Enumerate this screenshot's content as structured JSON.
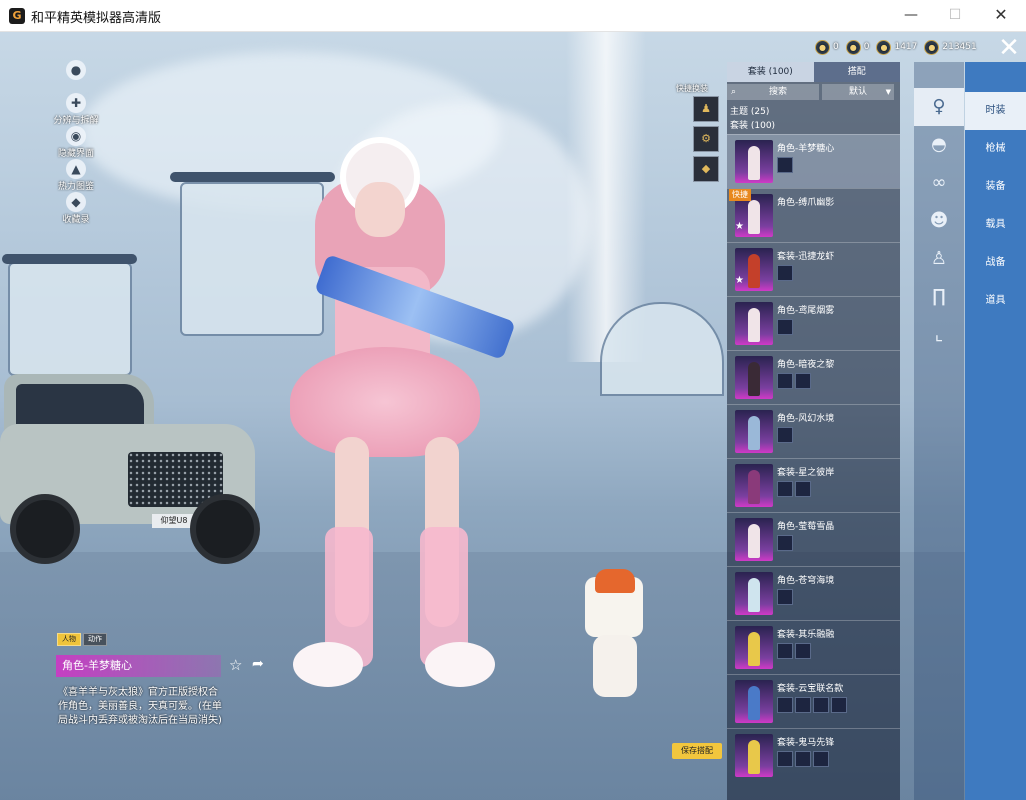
{
  "window": {
    "title": "和平精英模拟器高清版",
    "icon": "G",
    "minimize": "—",
    "maximize": "☐",
    "close": "✕"
  },
  "scene": {
    "car_plate": "仰望U8"
  },
  "left_menu": [
    {
      "icon": "user-icon",
      "glyph": "●",
      "label": ""
    },
    {
      "icon": "share-split-icon",
      "glyph": "✚",
      "label": "分辨与拆解"
    },
    {
      "icon": "eye-icon",
      "glyph": "◉",
      "label": "隐藏界面"
    },
    {
      "icon": "bag-icon",
      "glyph": "▲",
      "label": "热力图鉴"
    },
    {
      "icon": "gift-icon",
      "glyph": "◆",
      "label": "收藏录"
    }
  ],
  "currency": [
    {
      "icon": "token-icon",
      "glyph": "●",
      "value": "0"
    },
    {
      "icon": "badge-icon",
      "glyph": "●",
      "value": "0"
    },
    {
      "icon": "coin-icon",
      "glyph": "●",
      "value": "1417"
    },
    {
      "icon": "gold-coin-icon",
      "glyph": "●",
      "value": "213451"
    }
  ],
  "quick": {
    "label": "快捷换装",
    "slots": [
      "♟",
      "⚙",
      "◆"
    ]
  },
  "panel": {
    "tabs": [
      "套装 (100)",
      "搭配"
    ],
    "search_label": "搜索",
    "sort_label": "默认",
    "theme_label": "主题 (25)",
    "suit_label": "套装 (100)",
    "items": [
      {
        "name": "角色-羊梦糖心",
        "minis": 1,
        "tag": ""
      },
      {
        "name": "角色-缚爪幽影",
        "minis": 0,
        "tag": "快捷"
      },
      {
        "name": "套装-迅捷龙虾",
        "minis": 1,
        "tag": ""
      },
      {
        "name": "角色-鸢尾烟雾",
        "minis": 1,
        "tag": ""
      },
      {
        "name": "角色-暗夜之黎",
        "minis": 2,
        "tag": ""
      },
      {
        "name": "角色-风幻水境",
        "minis": 1,
        "tag": ""
      },
      {
        "name": "套装-星之彼岸",
        "minis": 2,
        "tag": ""
      },
      {
        "name": "角色-莹莓雪晶",
        "minis": 1,
        "tag": ""
      },
      {
        "name": "角色-苍穹海境",
        "minis": 1,
        "tag": ""
      },
      {
        "name": "套装-其乐融融",
        "minis": 2,
        "tag": ""
      },
      {
        "name": "套装-云宝联名款",
        "minis": 4,
        "tag": ""
      },
      {
        "name": "套装-鬼马先锋",
        "minis": 3,
        "tag": ""
      }
    ],
    "save_label": "保存搭配"
  },
  "icon_bar": [
    {
      "icon": "character-icon",
      "glyph": "♀"
    },
    {
      "icon": "hat-icon",
      "glyph": "◓"
    },
    {
      "icon": "glasses-icon",
      "glyph": "∞"
    },
    {
      "icon": "mask-icon",
      "glyph": "☻"
    },
    {
      "icon": "outfit-icon",
      "glyph": "♙"
    },
    {
      "icon": "pants-icon",
      "glyph": "∏"
    },
    {
      "icon": "shoes-icon",
      "glyph": "⌞"
    }
  ],
  "categories": [
    "时装",
    "枪械",
    "装备",
    "载具",
    "战备",
    "道具"
  ],
  "info": {
    "tags": [
      "人物",
      "动作"
    ],
    "name": "角色-羊梦糖心",
    "fav_glyph": "☆",
    "share_glyph": "➦",
    "description": "《喜羊羊与灰太狼》官方正版授权合作角色，美丽善良，天真可爱。(在单局战斗内丢弃或被淘汰后在当局消失)"
  }
}
